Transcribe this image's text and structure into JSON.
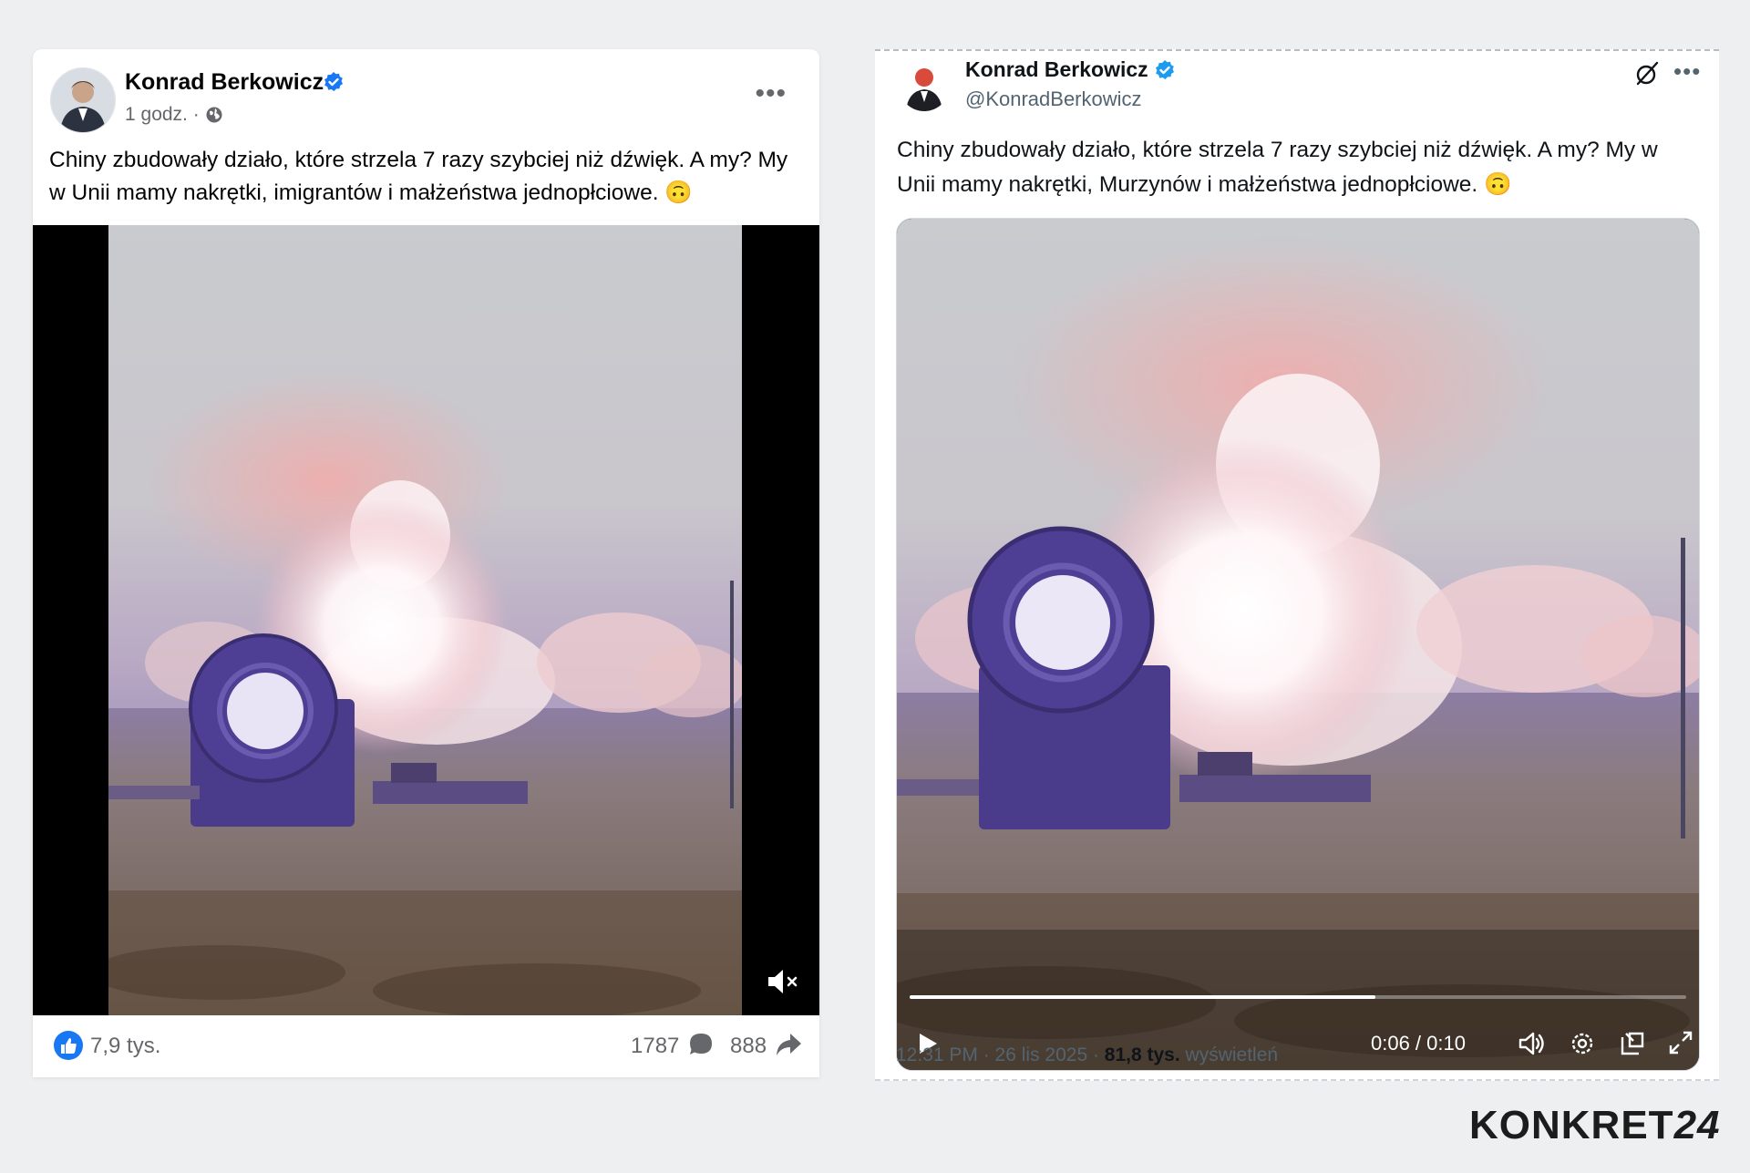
{
  "facebook_post": {
    "author": "Konrad Berkowicz",
    "time": "1 godz. ·",
    "text": "Chiny zbudowały działo, które strzela 7 razy szybciej niż dźwięk. A my? My w Unii mamy nakrętki, imigrantów i małżeństwa jednopłciowe. 🙃",
    "likes": "7,9 tys.",
    "comments": "1787",
    "shares": "888",
    "icons": [
      "verified-badge-icon",
      "globe-icon",
      "more-icon",
      "mute-icon",
      "like-icon",
      "comment-icon",
      "share-icon"
    ]
  },
  "x_post": {
    "author": "Konrad Berkowicz",
    "handle": "@KonradBerkowicz",
    "text": "Chiny zbudowały działo, które strzela 7 razy szybciej niż dźwięk. A my? My w Unii mamy nakrętki, Murzynów i małżeństwa jednopłciowe. 🙃",
    "video_time": "0:06 / 0:10",
    "video_progress": 0.6,
    "timestamp": "12:31 PM · 26 lis 2025 ·",
    "views_count": "81,8 tys.",
    "views_label": "wyświetleń",
    "icons": [
      "verified-badge-icon",
      "grok-icon",
      "more-icon",
      "play-icon",
      "volume-icon",
      "settings-icon",
      "pip-icon",
      "fullscreen-icon"
    ]
  },
  "watermark": {
    "brand_text": "KONKRET",
    "brand_number": "24"
  },
  "colors": {
    "fb_blue": "#1877f2",
    "x_blue": "#1d9bf0",
    "background": "#eeeff1"
  }
}
